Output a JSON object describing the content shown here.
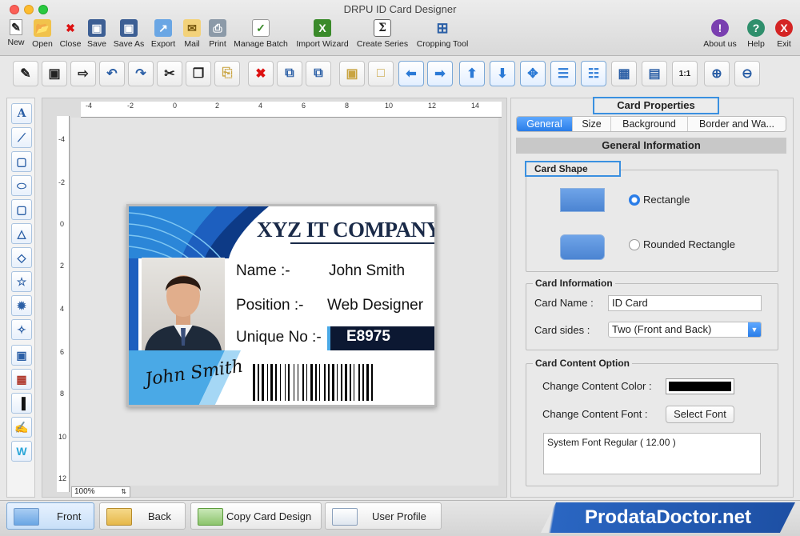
{
  "window": {
    "title": "DRPU ID Card Designer"
  },
  "toolbar": [
    {
      "label": "New",
      "icon": "new-icon"
    },
    {
      "label": "Open",
      "icon": "open-icon"
    },
    {
      "label": "Close",
      "icon": "close-doc-icon"
    },
    {
      "label": "Save",
      "icon": "save-icon"
    },
    {
      "label": "Save As",
      "icon": "save-as-icon"
    },
    {
      "label": "Export",
      "icon": "export-icon"
    },
    {
      "label": "Mail",
      "icon": "mail-icon"
    },
    {
      "label": "Print",
      "icon": "print-icon"
    },
    {
      "label": "Manage Batch",
      "icon": "manage-batch-icon"
    },
    {
      "label": "Import Wizard",
      "icon": "import-wizard-icon"
    },
    {
      "label": "Create Series",
      "icon": "create-series-icon"
    },
    {
      "label": "Cropping Tool",
      "icon": "cropping-tool-icon"
    },
    {
      "label": "About us",
      "icon": "about-icon"
    },
    {
      "label": "Help",
      "icon": "help-icon"
    },
    {
      "label": "Exit",
      "icon": "exit-icon"
    }
  ],
  "canvas": {
    "zoom": "100%"
  },
  "card": {
    "company": "XYZ IT COMPANY",
    "name_label": "Name :-",
    "name_value": "John Smith",
    "position_label": "Position :-",
    "position_value": "Web Designer",
    "unique_label": "Unique No :-",
    "unique_value": "E8975",
    "signature": "John Smith"
  },
  "properties": {
    "title": "Card Properties",
    "tabs": [
      "General",
      "Size",
      "Background",
      "Border and Wa..."
    ],
    "active_tab": "General",
    "section_title": "General Information",
    "card_shape": {
      "label": "Card Shape",
      "options": [
        "Rectangle",
        "Rounded Rectangle"
      ],
      "selected": "Rectangle"
    },
    "card_info": {
      "label": "Card Information",
      "name_label": "Card Name :",
      "name_value": "ID Card",
      "sides_label": "Card sides :",
      "sides_value": "Two (Front and Back)"
    },
    "content_option": {
      "label": "Card Content Option",
      "color_label": "Change Content Color :",
      "color_value": "#000000",
      "font_label": "Change Content Font :",
      "font_button": "Select Font",
      "font_value": "System Font Regular ( 12.00 )"
    }
  },
  "bottom": {
    "front": "Front",
    "back": "Back",
    "copy": "Copy Card Design",
    "profile": "User Profile",
    "brand": "ProdataDoctor.net"
  },
  "colors": {
    "accent": "#2a7de8",
    "card_navy": "#1a2a48",
    "card_blue": "#4aa9e6"
  }
}
